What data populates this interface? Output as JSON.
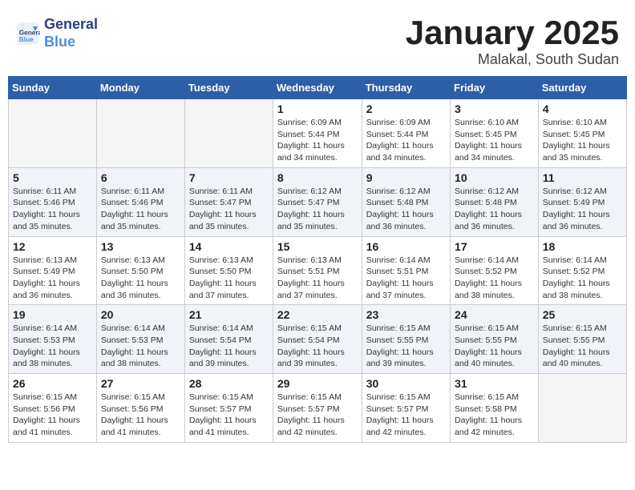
{
  "header": {
    "logo_line1": "General",
    "logo_line2": "Blue",
    "month_title": "January 2025",
    "location": "Malakal, South Sudan"
  },
  "weekdays": [
    "Sunday",
    "Monday",
    "Tuesday",
    "Wednesday",
    "Thursday",
    "Friday",
    "Saturday"
  ],
  "weeks": [
    [
      {
        "day": "",
        "info": ""
      },
      {
        "day": "",
        "info": ""
      },
      {
        "day": "",
        "info": ""
      },
      {
        "day": "1",
        "info": "Sunrise: 6:09 AM\nSunset: 5:44 PM\nDaylight: 11 hours\nand 34 minutes."
      },
      {
        "day": "2",
        "info": "Sunrise: 6:09 AM\nSunset: 5:44 PM\nDaylight: 11 hours\nand 34 minutes."
      },
      {
        "day": "3",
        "info": "Sunrise: 6:10 AM\nSunset: 5:45 PM\nDaylight: 11 hours\nand 34 minutes."
      },
      {
        "day": "4",
        "info": "Sunrise: 6:10 AM\nSunset: 5:45 PM\nDaylight: 11 hours\nand 35 minutes."
      }
    ],
    [
      {
        "day": "5",
        "info": "Sunrise: 6:11 AM\nSunset: 5:46 PM\nDaylight: 11 hours\nand 35 minutes."
      },
      {
        "day": "6",
        "info": "Sunrise: 6:11 AM\nSunset: 5:46 PM\nDaylight: 11 hours\nand 35 minutes."
      },
      {
        "day": "7",
        "info": "Sunrise: 6:11 AM\nSunset: 5:47 PM\nDaylight: 11 hours\nand 35 minutes."
      },
      {
        "day": "8",
        "info": "Sunrise: 6:12 AM\nSunset: 5:47 PM\nDaylight: 11 hours\nand 35 minutes."
      },
      {
        "day": "9",
        "info": "Sunrise: 6:12 AM\nSunset: 5:48 PM\nDaylight: 11 hours\nand 36 minutes."
      },
      {
        "day": "10",
        "info": "Sunrise: 6:12 AM\nSunset: 5:48 PM\nDaylight: 11 hours\nand 36 minutes."
      },
      {
        "day": "11",
        "info": "Sunrise: 6:12 AM\nSunset: 5:49 PM\nDaylight: 11 hours\nand 36 minutes."
      }
    ],
    [
      {
        "day": "12",
        "info": "Sunrise: 6:13 AM\nSunset: 5:49 PM\nDaylight: 11 hours\nand 36 minutes."
      },
      {
        "day": "13",
        "info": "Sunrise: 6:13 AM\nSunset: 5:50 PM\nDaylight: 11 hours\nand 36 minutes."
      },
      {
        "day": "14",
        "info": "Sunrise: 6:13 AM\nSunset: 5:50 PM\nDaylight: 11 hours\nand 37 minutes."
      },
      {
        "day": "15",
        "info": "Sunrise: 6:13 AM\nSunset: 5:51 PM\nDaylight: 11 hours\nand 37 minutes."
      },
      {
        "day": "16",
        "info": "Sunrise: 6:14 AM\nSunset: 5:51 PM\nDaylight: 11 hours\nand 37 minutes."
      },
      {
        "day": "17",
        "info": "Sunrise: 6:14 AM\nSunset: 5:52 PM\nDaylight: 11 hours\nand 38 minutes."
      },
      {
        "day": "18",
        "info": "Sunrise: 6:14 AM\nSunset: 5:52 PM\nDaylight: 11 hours\nand 38 minutes."
      }
    ],
    [
      {
        "day": "19",
        "info": "Sunrise: 6:14 AM\nSunset: 5:53 PM\nDaylight: 11 hours\nand 38 minutes."
      },
      {
        "day": "20",
        "info": "Sunrise: 6:14 AM\nSunset: 5:53 PM\nDaylight: 11 hours\nand 38 minutes."
      },
      {
        "day": "21",
        "info": "Sunrise: 6:14 AM\nSunset: 5:54 PM\nDaylight: 11 hours\nand 39 minutes."
      },
      {
        "day": "22",
        "info": "Sunrise: 6:15 AM\nSunset: 5:54 PM\nDaylight: 11 hours\nand 39 minutes."
      },
      {
        "day": "23",
        "info": "Sunrise: 6:15 AM\nSunset: 5:55 PM\nDaylight: 11 hours\nand 39 minutes."
      },
      {
        "day": "24",
        "info": "Sunrise: 6:15 AM\nSunset: 5:55 PM\nDaylight: 11 hours\nand 40 minutes."
      },
      {
        "day": "25",
        "info": "Sunrise: 6:15 AM\nSunset: 5:55 PM\nDaylight: 11 hours\nand 40 minutes."
      }
    ],
    [
      {
        "day": "26",
        "info": "Sunrise: 6:15 AM\nSunset: 5:56 PM\nDaylight: 11 hours\nand 41 minutes."
      },
      {
        "day": "27",
        "info": "Sunrise: 6:15 AM\nSunset: 5:56 PM\nDaylight: 11 hours\nand 41 minutes."
      },
      {
        "day": "28",
        "info": "Sunrise: 6:15 AM\nSunset: 5:57 PM\nDaylight: 11 hours\nand 41 minutes."
      },
      {
        "day": "29",
        "info": "Sunrise: 6:15 AM\nSunset: 5:57 PM\nDaylight: 11 hours\nand 42 minutes."
      },
      {
        "day": "30",
        "info": "Sunrise: 6:15 AM\nSunset: 5:57 PM\nDaylight: 11 hours\nand 42 minutes."
      },
      {
        "day": "31",
        "info": "Sunrise: 6:15 AM\nSunset: 5:58 PM\nDaylight: 11 hours\nand 42 minutes."
      },
      {
        "day": "",
        "info": ""
      }
    ]
  ]
}
